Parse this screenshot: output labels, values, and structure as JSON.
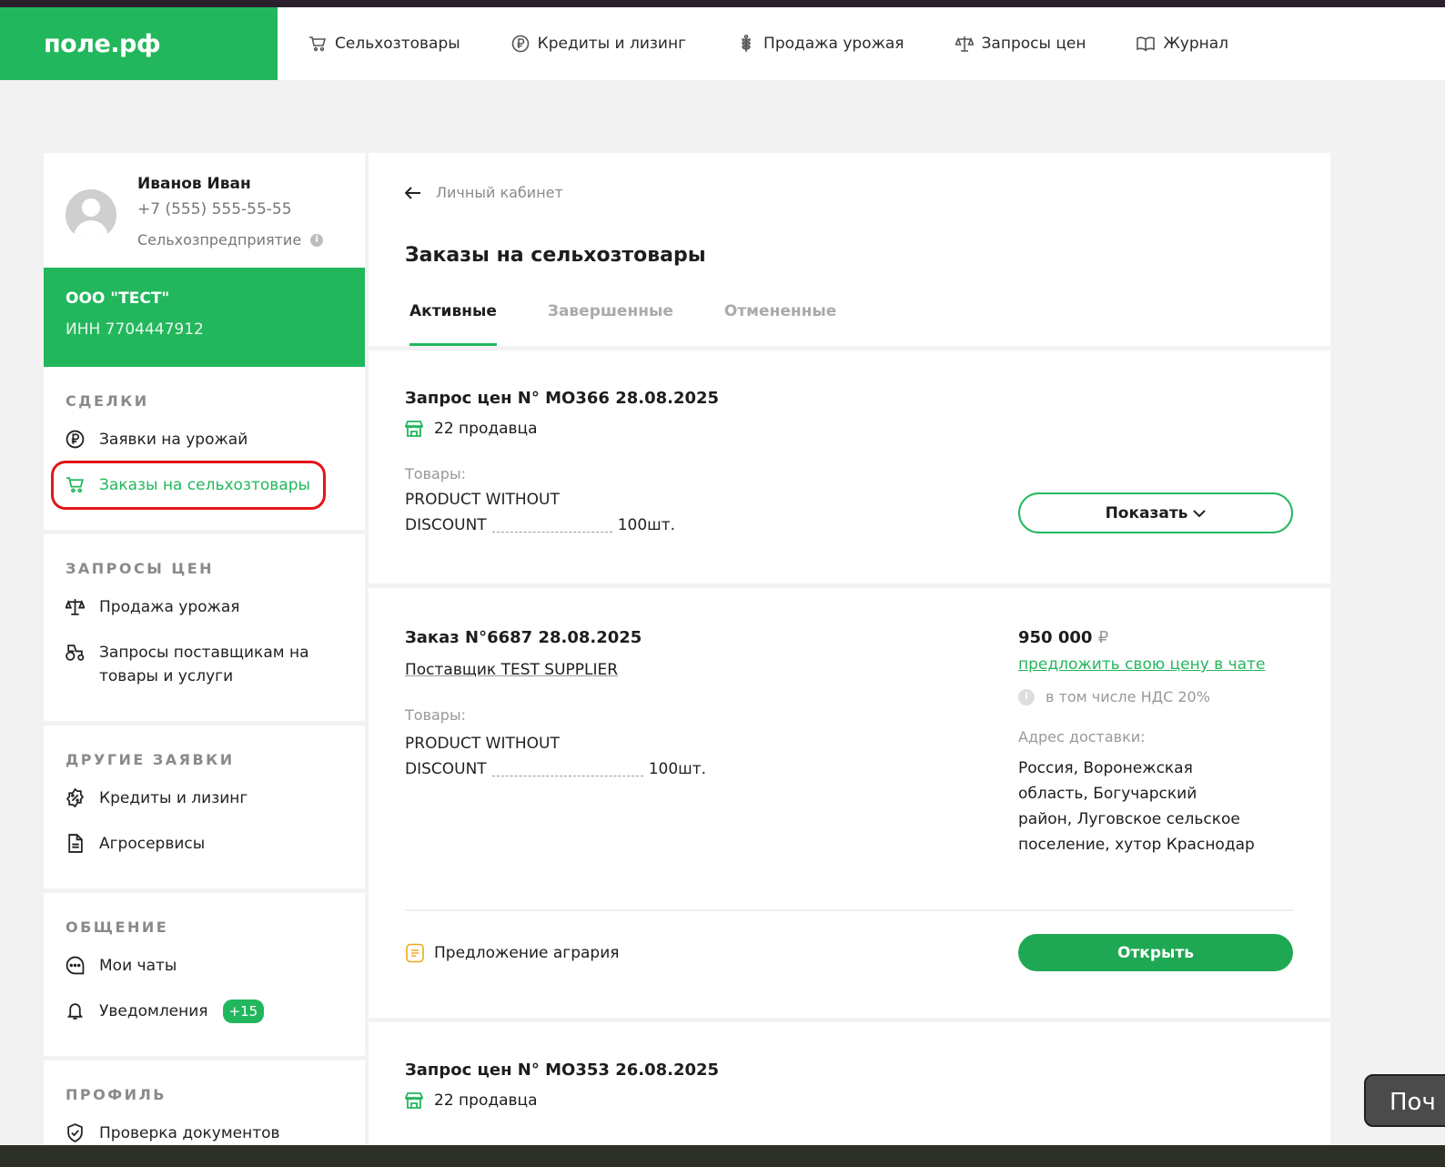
{
  "header": {
    "logo": "поле.рф",
    "nav": [
      {
        "label": "Сельхозтовары",
        "icon": "cart-icon"
      },
      {
        "label": "Кредиты и лизинг",
        "icon": "ruble-coin-icon"
      },
      {
        "label": "Продажа урожая",
        "icon": "wheat-icon"
      },
      {
        "label": "Запросы цен",
        "icon": "scales-icon"
      },
      {
        "label": "Журнал",
        "icon": "book-icon"
      }
    ]
  },
  "profile": {
    "name": "Иванов Иван",
    "phone": "+7 (555) 555-55-55",
    "type": "Сельхозпредприятие",
    "info_symbol": "i"
  },
  "company": {
    "name": "ООО \"ТЕСТ\"",
    "inn": "ИНН 7704447912"
  },
  "sidebar": {
    "deals": {
      "title": "СДЕЛКИ",
      "items": [
        "Заявки на урожай",
        "Заказы на сельхозтовары"
      ]
    },
    "price_requests": {
      "title": "ЗАПРОСЫ ЦЕН",
      "items": [
        "Продажа урожая",
        "Запросы поставщикам на товары и услуги"
      ]
    },
    "other": {
      "title": "ДРУГИЕ ЗАЯВКИ",
      "items": [
        "Кредиты и лизинг",
        "Агросервисы"
      ]
    },
    "communication": {
      "title": "ОБЩЕНИЕ",
      "items": [
        "Мои чаты",
        "Уведомления"
      ],
      "badge": "+15"
    },
    "profile_section": {
      "title": "ПРОФИЛЬ",
      "items": [
        "Проверка документов"
      ]
    }
  },
  "main": {
    "back_label": "Личный кабинет",
    "title": "Заказы на сельхозтовары",
    "tabs": [
      "Активные",
      "Завершенные",
      "Отмененные"
    ],
    "orders": [
      {
        "title": "Запрос цен N° МО366 28.08.2025",
        "sellers": "22 продавца",
        "goods_label": "Товары:",
        "product_line1": "PRODUCT WITHOUT",
        "product_line2": "DISCOUNT",
        "qty": "100шт.",
        "button": "Показать"
      },
      {
        "title": "Заказ N°6687 28.08.2025",
        "supplier": "Поставщик TEST SUPPLIER",
        "goods_label": "Товары:",
        "product_line1": "PRODUCT WITHOUT",
        "product_line2": "DISCOUNT",
        "qty": "100шт.",
        "price": "950 000",
        "currency": "₽",
        "offer_link": "предложить свою цену в чате",
        "vat": "в том числе НДС 20%",
        "address_label": "Адрес доставки:",
        "address": "Россия, Воронежская область, Богучарский район, Луговское сельское поселение, хутор Краснодар",
        "proposal": "Предложение агрария",
        "button": "Открыть"
      },
      {
        "title": "Запрос цен N° МО353 26.08.2025",
        "sellers": "22 продавца"
      }
    ]
  },
  "chat_widget": {
    "label": "Поч"
  },
  "colors": {
    "brand_green": "#23b75d",
    "highlight_red": "#e3151a"
  }
}
